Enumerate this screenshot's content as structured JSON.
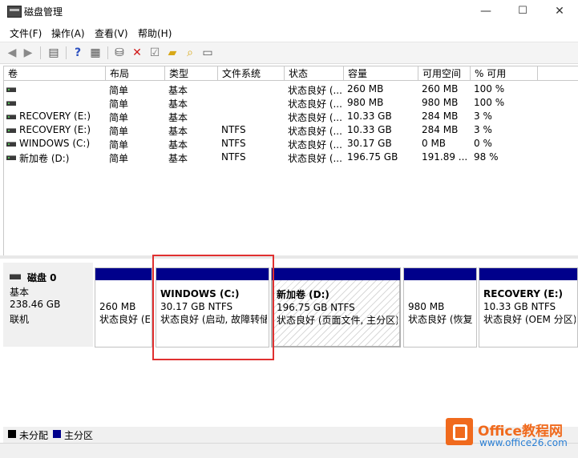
{
  "window": {
    "title": "磁盘管理",
    "minimize": "—",
    "maximize": "☐",
    "close": "✕"
  },
  "menu": [
    "文件(F)",
    "操作(A)",
    "查看(V)",
    "帮助(H)"
  ],
  "volume_columns": [
    "卷",
    "布局",
    "类型",
    "文件系统",
    "状态",
    "容量",
    "可用空间",
    "% 可用"
  ],
  "volumes": [
    {
      "name": "",
      "layout": "简单",
      "type": "基本",
      "fs": "",
      "status": "状态良好 (...",
      "capacity": "260 MB",
      "free": "260 MB",
      "pct": "100 %"
    },
    {
      "name": "",
      "layout": "简单",
      "type": "基本",
      "fs": "",
      "status": "状态良好 (...",
      "capacity": "980 MB",
      "free": "980 MB",
      "pct": "100 %"
    },
    {
      "name": "RECOVERY (E:)",
      "layout": "简单",
      "type": "基本",
      "fs": "",
      "status": "状态良好 (...",
      "capacity": "10.33 GB",
      "free": "284 MB",
      "pct": "3 %"
    },
    {
      "name": "RECOVERY (E:)",
      "layout": "简单",
      "type": "基本",
      "fs": "NTFS",
      "status": "状态良好 (...",
      "capacity": "10.33 GB",
      "free": "284 MB",
      "pct": "3 %"
    },
    {
      "name": "WINDOWS (C:)",
      "layout": "简单",
      "type": "基本",
      "fs": "NTFS",
      "status": "状态良好 (...",
      "capacity": "30.17 GB",
      "free": "0 MB",
      "pct": "0 %"
    },
    {
      "name": "新加卷 (D:)",
      "layout": "简单",
      "type": "基本",
      "fs": "NTFS",
      "status": "状态良好 (...",
      "capacity": "196.75 GB",
      "free": "191.89 ...",
      "pct": "98 %"
    }
  ],
  "disk": {
    "name": "磁盘 0",
    "kind": "基本",
    "size": "238.46 GB",
    "state": "联机"
  },
  "partitions": [
    {
      "title": "",
      "size": "260 MB",
      "status": "状态良好 (E"
    },
    {
      "title": "WINDOWS  (C:)",
      "size": "30.17 GB NTFS",
      "status": "状态良好 (启动, 故障转储"
    },
    {
      "title": "新加卷  (D:)",
      "size": "196.75 GB NTFS",
      "status": "状态良好 (页面文件, 主分区)"
    },
    {
      "title": "",
      "size": "980 MB",
      "status": "状态良好 (恢复"
    },
    {
      "title": "RECOVERY  (E:)",
      "size": "10.33 GB NTFS",
      "status": "状态良好 (OEM 分区)"
    }
  ],
  "legend": {
    "unallocated": "未分配",
    "primary": "主分区",
    "unallocated_color": "#000000",
    "primary_color": "#00008b"
  },
  "watermark": {
    "brand": "Office教程网",
    "url": "www.office26.com"
  }
}
